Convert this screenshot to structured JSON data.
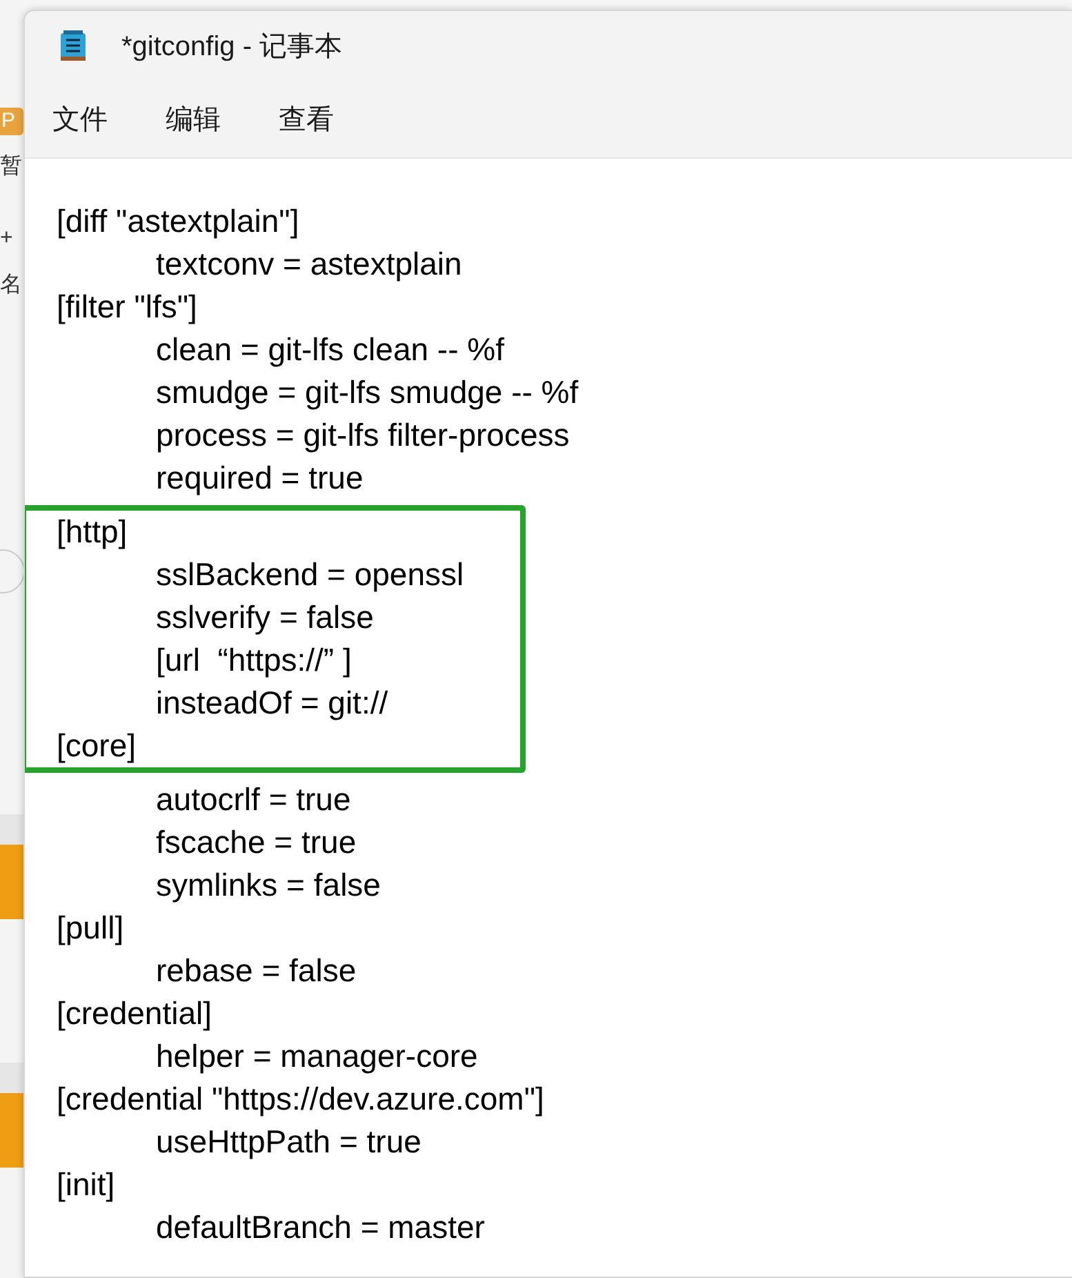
{
  "background_window": {
    "badge": "P",
    "labels": [
      "暂",
      "+",
      "名"
    ]
  },
  "window": {
    "title": "*gitconfig - 记事本"
  },
  "menu": [
    "文件",
    "编辑",
    "查看"
  ],
  "editor": {
    "blocks": [
      {
        "highlighted": false,
        "lines": [
          {
            "kind": "section",
            "text": "[diff \"astextplain\"]"
          },
          {
            "kind": "setting",
            "text": "textconv = astextplain"
          },
          {
            "kind": "section",
            "text": "[filter \"lfs\"]"
          },
          {
            "kind": "setting",
            "text": "clean = git-lfs clean -- %f"
          },
          {
            "kind": "setting",
            "text": "smudge = git-lfs smudge -- %f"
          },
          {
            "kind": "setting",
            "text": "process = git-lfs filter-process"
          },
          {
            "kind": "setting",
            "text": "required = true"
          }
        ]
      },
      {
        "highlighted": true,
        "lines": [
          {
            "kind": "section",
            "text": "[http]"
          },
          {
            "kind": "setting",
            "text": "sslBackend = openssl"
          },
          {
            "kind": "setting",
            "text": "sslverify = false"
          },
          {
            "kind": "setting",
            "text": "[url  “https://” ]"
          },
          {
            "kind": "setting",
            "text": "insteadOf = git://"
          },
          {
            "kind": "section",
            "text": "[core]"
          }
        ]
      },
      {
        "highlighted": false,
        "lines": [
          {
            "kind": "setting",
            "text": "autocrlf = true"
          },
          {
            "kind": "setting",
            "text": "fscache = true"
          },
          {
            "kind": "setting",
            "text": "symlinks = false"
          },
          {
            "kind": "section",
            "text": "[pull]"
          },
          {
            "kind": "setting",
            "text": "rebase = false"
          },
          {
            "kind": "section",
            "text": "[credential]"
          },
          {
            "kind": "setting",
            "text": "helper = manager-core"
          },
          {
            "kind": "section",
            "text": "[credential \"https://dev.azure.com\"]"
          },
          {
            "kind": "setting",
            "text": "useHttpPath = true"
          },
          {
            "kind": "section",
            "text": "[init]"
          },
          {
            "kind": "setting",
            "text": "defaultBranch = master"
          }
        ]
      }
    ]
  }
}
